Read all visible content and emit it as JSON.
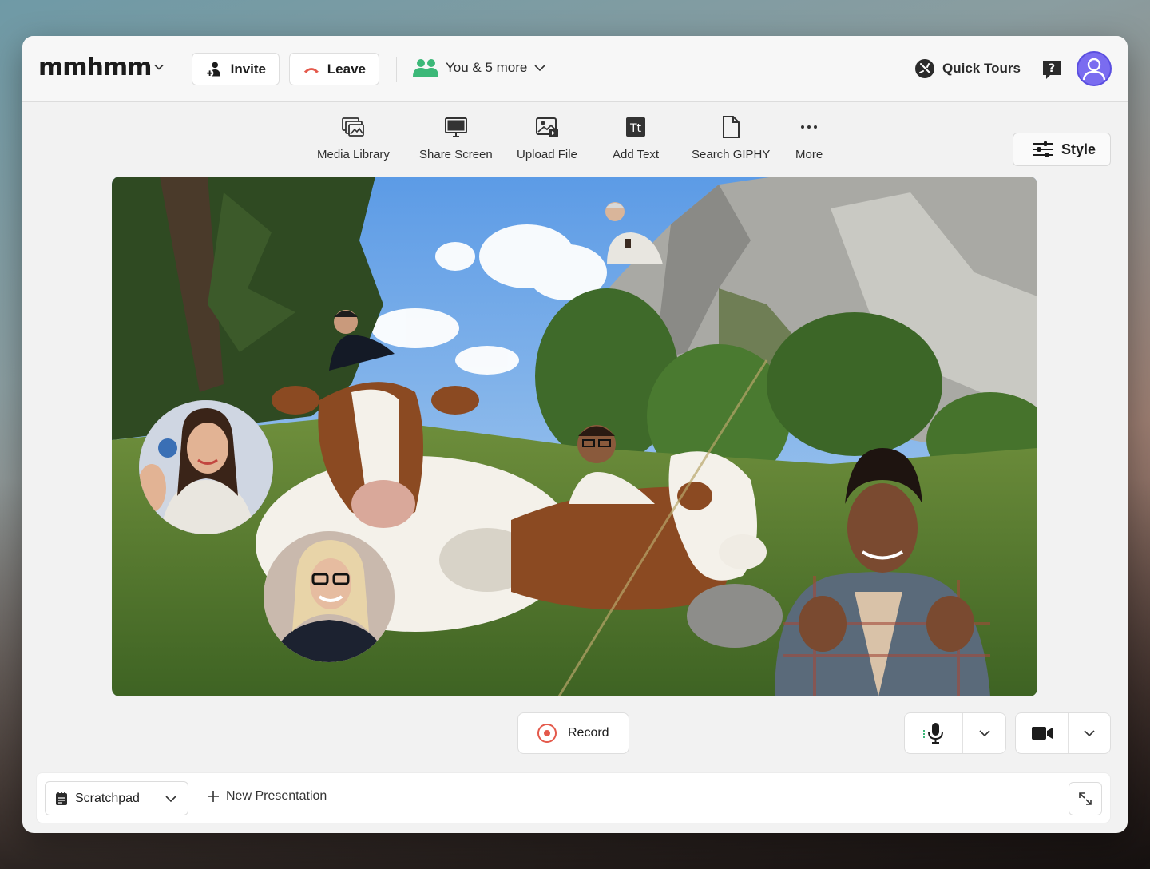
{
  "app": {
    "logo_text": "mmhmm"
  },
  "header": {
    "invite_label": "Invite",
    "leave_label": "Leave",
    "participants_label": "You & 5 more",
    "quick_tours_label": "Quick Tours"
  },
  "toolbar": {
    "items": [
      {
        "label": "Media Library",
        "icon": "media-library-icon"
      },
      {
        "label": "Share Screen",
        "icon": "monitor-icon"
      },
      {
        "label": "Upload File",
        "icon": "upload-image-icon"
      },
      {
        "label": "Add Text",
        "icon": "text-icon"
      },
      {
        "label": "Search GIPHY",
        "icon": "file-icon"
      },
      {
        "label": "More",
        "icon": "ellipsis-icon"
      }
    ],
    "style_label": "Style"
  },
  "controls": {
    "record_label": "Record"
  },
  "bottom": {
    "scratchpad_label": "Scratchpad",
    "new_presentation_label": "New Presentation"
  },
  "colors": {
    "record": "#e4594b",
    "participants_icon": "#3cb878",
    "avatar": "#7a6cf0",
    "leave_icon": "#e4594b"
  }
}
